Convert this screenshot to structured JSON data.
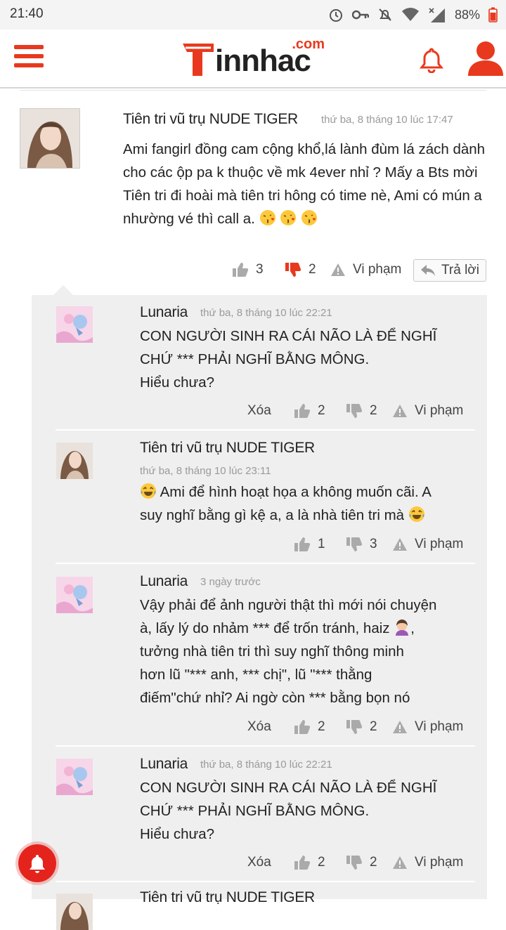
{
  "status_bar": {
    "time": "21:40",
    "battery": "88%"
  },
  "header": {
    "logo_word": "innhac",
    "logo_suffix": ".com"
  },
  "comment": {
    "author": "Tiên tri vũ trụ NUDE TIGER",
    "time": "thứ ba, 8 tháng 10 lúc 17:47",
    "text": "Ami fangirl đồng cam cộng khổ,lá lành đùm lá zách dành cho các ộp pa k thuộc về mk 4ever nhỉ ? Mấy a Bts mời Tiên tri đi hoài mà tiên tri hông có time nè, Ami có mún a nhường vé thì call a.",
    "likes": "3",
    "dislikes": "2",
    "report_label": "Vi phạm",
    "reply_label": "Trả lời"
  },
  "replies": [
    {
      "author": "Lunaria",
      "time": "thứ ba, 8 tháng 10 lúc 22:21",
      "text_lines": [
        "CON NGƯỜI SINH RA CÁI NÃO LÀ ĐỂ NGHĨ",
        "CHỨ *** PHẢI NGHĨ BẰNG MÔNG.",
        "Hiểu chưa?"
      ],
      "delete_label": "Xóa",
      "likes": "2",
      "dislikes": "2",
      "report_label": "Vi phạm"
    },
    {
      "author": "Tiên tri vũ trụ NUDE TIGER",
      "time": "thứ ba, 8 tháng 10 lúc 23:11",
      "text_a": "Ami để hình hoạt họa a không muốn cãi. A",
      "text_b": "suy nghĩ bằng gì kệ a, a là nhà tiên tri mà",
      "likes": "1",
      "dislikes": "3",
      "report_label": "Vi phạm"
    },
    {
      "author": "Lunaria",
      "time": "3 ngày trước",
      "text_lines": [
        "Vậy phải để ảnh người thật thì mới nói chuyện",
        "à, lấy lý do nhảm *** để trốn tránh, haiz",
        "tưởng nhà tiên tri thì suy nghĩ thông minh",
        "hơn lũ \"*** anh, *** chị\", lũ \"*** thằng",
        "điếm\"chứ nhỉ? Ai ngờ còn *** bằng bọn nó"
      ],
      "delete_label": "Xóa",
      "likes": "2",
      "dislikes": "2",
      "report_label": "Vi phạm"
    },
    {
      "author": "Lunaria",
      "time": "thứ ba, 8 tháng 10 lúc 22:21",
      "text_lines": [
        "CON NGƯỜI SINH RA CÁI NÃO LÀ ĐỂ NGHĨ",
        "CHỨ *** PHẢI NGHĨ BẰNG MÔNG.",
        "Hiểu chưa?"
      ],
      "delete_label": "Xóa",
      "likes": "2",
      "dislikes": "2",
      "report_label": "Vi phạm"
    },
    {
      "author": "Tiên tri vũ trụ NUDE TIGER"
    }
  ],
  "colors": {
    "brand_red": "#e8391e",
    "text": "#222222",
    "muted": "#9a9a9a",
    "reply_bg": "#efefef"
  },
  "icons": [
    "menu-icon",
    "bell-icon",
    "user-icon",
    "thumbs-up-icon",
    "thumbs-down-icon",
    "warning-icon",
    "reply-arrow-icon",
    "notification-bell-icon"
  ]
}
